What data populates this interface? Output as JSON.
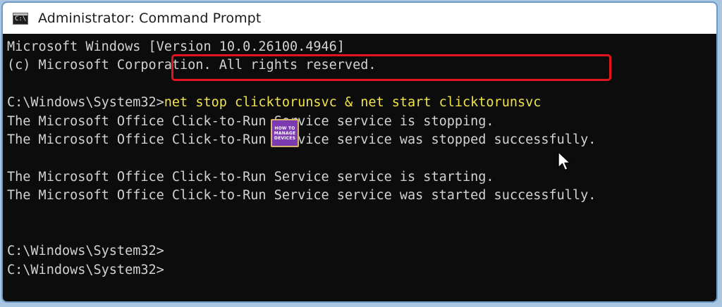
{
  "window": {
    "title": "Administrator: Command Prompt",
    "icon": "cmd-icon",
    "icon_glyph": "C:\\"
  },
  "console": {
    "lines": [
      "Microsoft Windows [Version 10.0.26100.4946]",
      "(c) Microsoft Corporation. All rights reserved.",
      "",
      "C:\\Windows\\System32>",
      "The Microsoft Office Click-to-Run Service service is stopping.",
      "The Microsoft Office Click-to-Run Service service was stopped successfully.",
      "",
      "The Microsoft Office Click-to-Run Service service is starting.",
      "The Microsoft Office Click-to-Run Service service was started successfully.",
      "",
      "",
      "C:\\Windows\\System32>",
      "C:\\Windows\\System32>"
    ],
    "command": "net stop clicktorunsvc & net start clicktorunsvc",
    "command_color": "#f0e34a",
    "text_color": "#d2d2d2",
    "background_color": "#0c0c0c"
  },
  "highlight_color": "#e3141c",
  "watermark": {
    "line1": "HOW TO",
    "line2": "MANAGE",
    "line3": "DEVICES"
  }
}
